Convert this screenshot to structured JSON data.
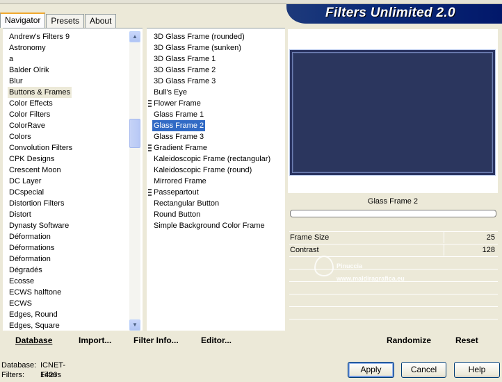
{
  "window": {
    "title_banner": "Filters Unlimited 2.0"
  },
  "tabs": [
    {
      "label": "Navigator",
      "active": true
    },
    {
      "label": "Presets",
      "active": false
    },
    {
      "label": "About",
      "active": false
    }
  ],
  "categories": {
    "selected": "Buttons & Frames",
    "items": [
      "Andrew's Filters 9",
      "Astronomy",
      "a",
      "Balder Olrik",
      "Blur",
      "Buttons & Frames",
      "Color Effects",
      "Color Filters",
      "ColorRave",
      "Colors",
      "Convolution Filters",
      "CPK Designs",
      "Crescent Moon",
      "DC Layer",
      "DCspecial",
      "Distortion Filters",
      "Distort",
      "Dynasty Software",
      "Déformation",
      "Déformations",
      "Déformation",
      "Dégradés",
      "Ecosse",
      "ECWS halftone",
      "ECWS",
      "Edges, Round",
      "Edges, Square"
    ]
  },
  "filters": {
    "selected": "Glass Frame 2",
    "items": [
      {
        "label": "3D Glass Frame (rounded)",
        "marker": false
      },
      {
        "label": "3D Glass Frame (sunken)",
        "marker": false
      },
      {
        "label": "3D Glass Frame 1",
        "marker": false
      },
      {
        "label": "3D Glass Frame 2",
        "marker": false
      },
      {
        "label": "3D Glass Frame 3",
        "marker": false
      },
      {
        "label": "Bull's Eye",
        "marker": false
      },
      {
        "label": "Flower Frame",
        "marker": true
      },
      {
        "label": "Glass Frame 1",
        "marker": false
      },
      {
        "label": "Glass Frame 2",
        "marker": false
      },
      {
        "label": "Glass Frame 3",
        "marker": false
      },
      {
        "label": "Gradient Frame",
        "marker": true
      },
      {
        "label": "Kaleidoscopic Frame (rectangular)",
        "marker": false
      },
      {
        "label": "Kaleidoscopic Frame (round)",
        "marker": false
      },
      {
        "label": "Mirrored Frame",
        "marker": false
      },
      {
        "label": "Passepartout",
        "marker": true
      },
      {
        "label": "Rectangular Button",
        "marker": false
      },
      {
        "label": "Round Button",
        "marker": false
      },
      {
        "label": "Simple Background Color Frame",
        "marker": false
      }
    ]
  },
  "preview": {
    "filter_name": "Glass Frame 2",
    "frame_color": "#2b365e"
  },
  "parameters": [
    {
      "label": "Frame Size",
      "value": "25"
    },
    {
      "label": "Contrast",
      "value": "128"
    }
  ],
  "watermark": {
    "name": "Pinuccia",
    "url": "www.maldiragrafica.eu"
  },
  "toolbar": {
    "database": "Database",
    "import": "Import...",
    "filter_info": "Filter Info...",
    "editor": "Editor...",
    "randomize": "Randomize",
    "reset": "Reset"
  },
  "status": {
    "database_label": "Database:",
    "database_value": "ICNET-Filters",
    "filters_label": "Filters:",
    "filters_value": "1426"
  },
  "buttons": {
    "apply": "Apply",
    "cancel": "Cancel",
    "help": "Help"
  },
  "colors": {
    "selection": "#316ac5",
    "banner": "#0a2a78",
    "preview": "#34406a"
  }
}
